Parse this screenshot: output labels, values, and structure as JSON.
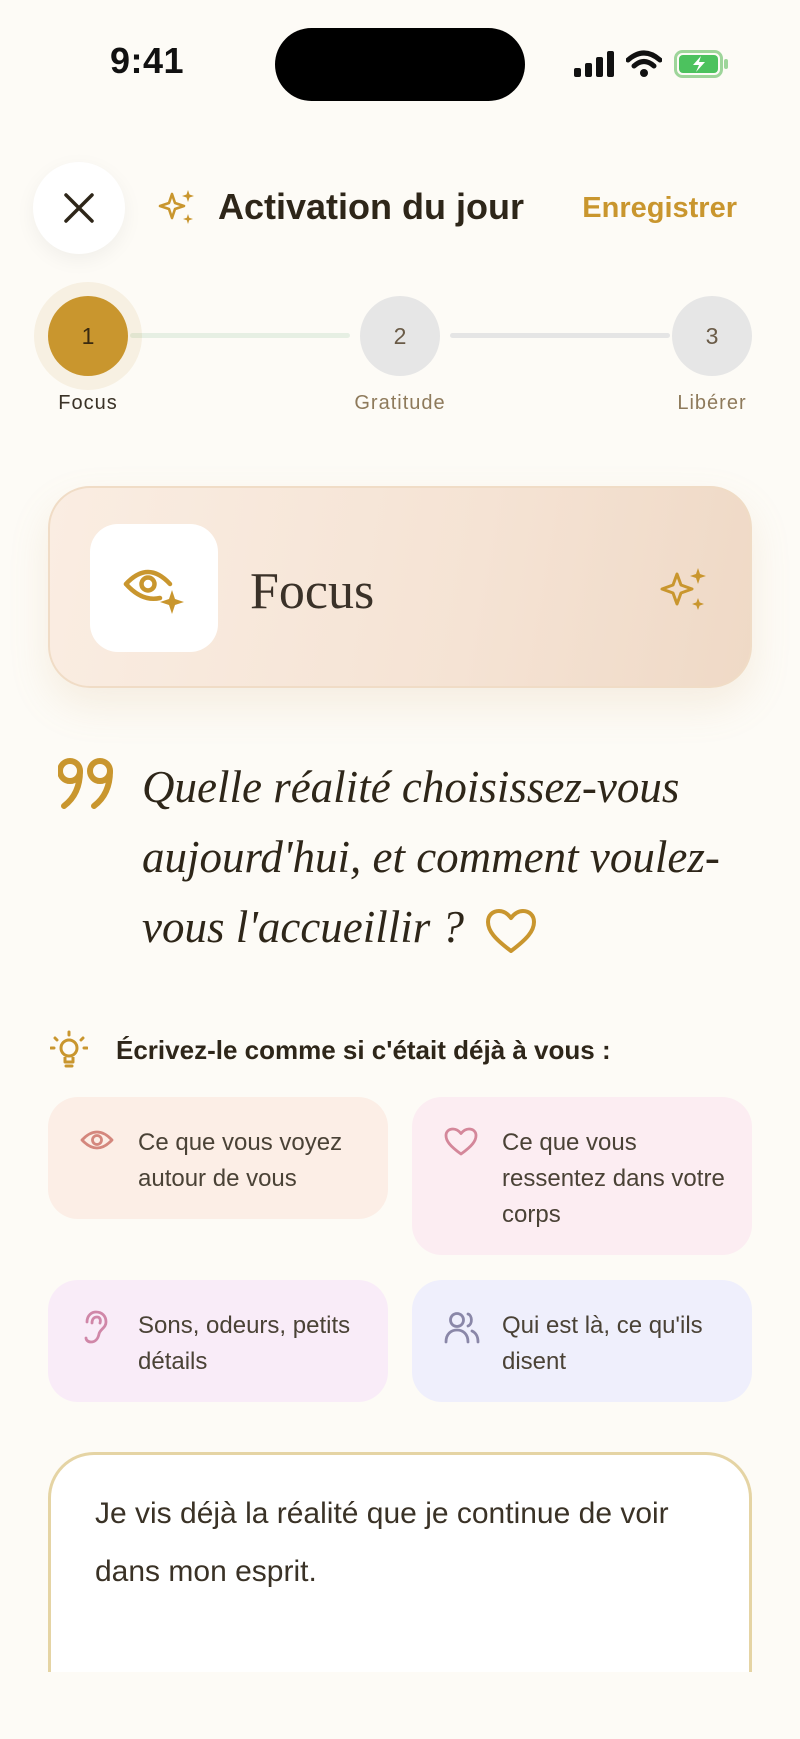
{
  "status_bar": {
    "time": "9:41"
  },
  "header": {
    "title": "Activation du jour",
    "save_label": "Enregistrer"
  },
  "stepper": {
    "steps": [
      {
        "number": "1",
        "label": "Focus",
        "active": true
      },
      {
        "number": "2",
        "label": "Gratitude",
        "active": false
      },
      {
        "number": "3",
        "label": "Libérer",
        "active": false
      }
    ]
  },
  "focus_card": {
    "title": "Focus"
  },
  "quote": {
    "text": "Quelle réalité choisissez-vous aujourd'hui, et comment voulez-vous l'accueillir ?"
  },
  "hint": {
    "text": "Écrivez-le comme si c'était déjà à vous :"
  },
  "prompts": [
    {
      "icon": "eye-icon",
      "text": "Ce que vous voyez autour de vous"
    },
    {
      "icon": "heart-icon",
      "text": "Ce que vous ressentez dans votre corps"
    },
    {
      "icon": "ear-icon",
      "text": "Sons, odeurs, petits détails"
    },
    {
      "icon": "people-icon",
      "text": "Qui est là, ce qu'ils disent"
    }
  ],
  "journal": {
    "value": "Je vis déjà la réalité que je continue de voir dans mon esprit."
  },
  "colors": {
    "accent": "#C9962E",
    "background": "#FDFBF6",
    "text": "#2E2619"
  }
}
